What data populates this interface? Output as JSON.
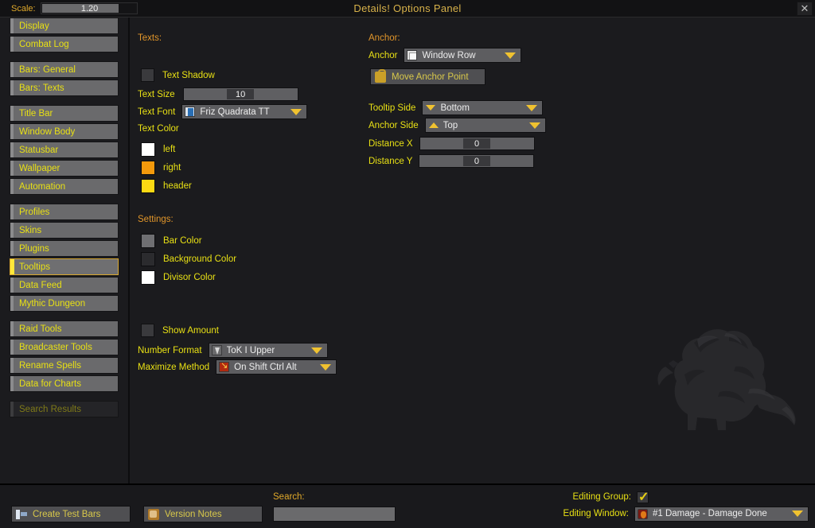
{
  "window": {
    "title": "Details! Options Panel",
    "close_label": "✕"
  },
  "scale": {
    "label": "Scale:",
    "value": "1.20"
  },
  "sidebar": {
    "groups": [
      {
        "items": [
          {
            "label": "Display",
            "state": "normal"
          },
          {
            "label": "Combat Log",
            "state": "normal"
          }
        ]
      },
      {
        "items": [
          {
            "label": "Bars: General",
            "state": "normal"
          },
          {
            "label": "Bars: Texts",
            "state": "normal"
          }
        ]
      },
      {
        "items": [
          {
            "label": "Title Bar",
            "state": "normal"
          },
          {
            "label": "Window Body",
            "state": "normal"
          },
          {
            "label": "Statusbar",
            "state": "normal"
          },
          {
            "label": "Wallpaper",
            "state": "normal"
          },
          {
            "label": "Automation",
            "state": "normal"
          }
        ]
      },
      {
        "items": [
          {
            "label": "Profiles",
            "state": "normal"
          },
          {
            "label": "Skins",
            "state": "normal"
          },
          {
            "label": "Plugins",
            "state": "normal"
          },
          {
            "label": "Tooltips",
            "state": "active"
          },
          {
            "label": "Data Feed",
            "state": "normal"
          },
          {
            "label": "Mythic Dungeon",
            "state": "normal"
          }
        ]
      },
      {
        "items": [
          {
            "label": "Raid Tools",
            "state": "normal"
          },
          {
            "label": "Broadcaster Tools",
            "state": "normal"
          },
          {
            "label": "Rename Spells",
            "state": "normal"
          },
          {
            "label": "Data for Charts",
            "state": "normal"
          }
        ]
      },
      {
        "items": [
          {
            "label": "Search Results",
            "state": "disabled"
          }
        ]
      }
    ]
  },
  "texts_section": {
    "header": "Texts:",
    "text_shadow": {
      "label": "Text Shadow",
      "checked": false
    },
    "text_size": {
      "label": "Text Size",
      "value": "10"
    },
    "text_font": {
      "label": "Text Font",
      "value": "Friz Quadrata TT",
      "icon": "font-icon"
    }
  },
  "text_color_section": {
    "header": "Text Color",
    "swatches": [
      {
        "label": "left",
        "color": "#ffffff"
      },
      {
        "label": "right",
        "color": "#f49a0c"
      },
      {
        "label": "header",
        "color": "#fbd913"
      }
    ]
  },
  "settings_section": {
    "header": "Settings:",
    "swatches": [
      {
        "label": "Bar Color",
        "color": "#6f6f72"
      },
      {
        "label": "Background Color",
        "color": "#2b2b2e"
      },
      {
        "label": "Divisor Color",
        "color": "#ffffff"
      }
    ],
    "show_amount": {
      "label": "Show Amount",
      "checked": false
    },
    "number_format": {
      "label": "Number Format",
      "value": "ToK I Upper",
      "icon": "hourglass-icon"
    },
    "maximize_method": {
      "label": "Maximize Method",
      "value": "On Shift Ctrl Alt",
      "icon": "alert-icon"
    }
  },
  "anchor_section": {
    "header": "Anchor:",
    "anchor": {
      "label": "Anchor",
      "value": "Window Row",
      "icon": "document-icon"
    },
    "move_anchor_point": {
      "label": "Move Anchor Point",
      "icon": "lock-icon"
    },
    "tooltip_side": {
      "label": "Tooltip Side",
      "value": "Bottom",
      "icon": "arrow-down-icon"
    },
    "anchor_side": {
      "label": "Anchor Side",
      "value": "Top",
      "icon": "arrow-up-icon"
    },
    "distance_x": {
      "label": "Distance X",
      "value": "0"
    },
    "distance_y": {
      "label": "Distance Y",
      "value": "0"
    }
  },
  "footer": {
    "create_test_bars": {
      "label": "Create Test Bars",
      "icon": "bars-icon"
    },
    "version_notes": {
      "label": "Version Notes",
      "icon": "scroll-icon"
    },
    "search": {
      "label": "Search:",
      "value": "",
      "placeholder": ""
    },
    "editing_group": {
      "label": "Editing Group:",
      "checked": true
    },
    "editing_window": {
      "label": "Editing Window:",
      "value": "#1 Damage - Damage Done",
      "icon": "damage-icon"
    }
  }
}
